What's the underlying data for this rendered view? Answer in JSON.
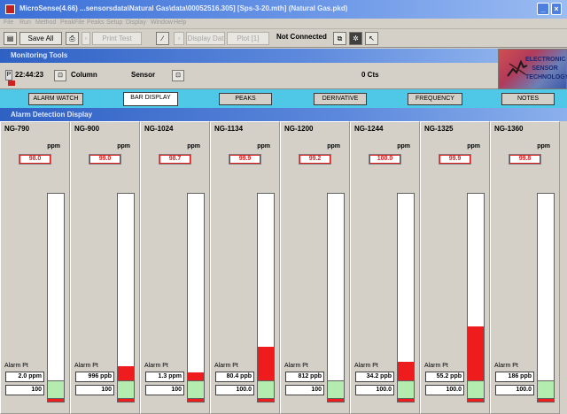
{
  "window": {
    "title": "MicroSense(4.66)   ...sensorsdata\\Natural Gas\\data\\00052516.305] [Sps-3-20.mth] (Natural Gas.pkd)"
  },
  "menu": [
    "File",
    "Run",
    "Method",
    "PeakFile",
    "Peaks",
    "Setup",
    "Display",
    "Window",
    "Help"
  ],
  "toolbar": {
    "save_all": "Save All",
    "dim_label_1": "Print Test",
    "dim_label_2": "Display Dat",
    "dim_label_3": "Plot [1]",
    "status": "Not Connected"
  },
  "monitoring": {
    "title": "Monitoring Tools",
    "time": "22:44:23",
    "column_label": "Column",
    "sensor_label": "Sensor",
    "counts": "0 Cts"
  },
  "logo": {
    "text_line1": "ELECTRONIC",
    "text_line2": "SENSOR",
    "text_line3": "TECHNOLOGY"
  },
  "tabs": [
    "ALARM WATCH",
    "BAR DISPLAY",
    "PEAKS",
    "DERIVATIVE",
    "FREQUENCY",
    "NOTES"
  ],
  "active_tab": "BAR DISPLAY",
  "section": {
    "title": "Alarm Detection Display"
  },
  "alarm_pt_label": "Alarm Pt",
  "channels": [
    {
      "name": "NG-790",
      "unit": "ppm",
      "value": "98.0",
      "alarm": "2.0 ppm",
      "range": "100",
      "level": 0.1
    },
    {
      "name": "NG-900",
      "unit": "ppm",
      "value": "99.0",
      "alarm": "996 ppb",
      "range": "100",
      "level": 0.17
    },
    {
      "name": "NG-1024",
      "unit": "ppm",
      "value": "98.7",
      "alarm": "1.3 ppm",
      "range": "100",
      "level": 0.14
    },
    {
      "name": "NG-1134",
      "unit": "ppm",
      "value": "99.9",
      "alarm": "80.4 ppb",
      "range": "100.0",
      "level": 0.26
    },
    {
      "name": "NG-1200",
      "unit": "ppm",
      "value": "99.2",
      "alarm": "812 ppb",
      "range": "100",
      "level": 0.04
    },
    {
      "name": "NG-1244",
      "unit": "ppm",
      "value": "100.0",
      "alarm": "34.2 ppb",
      "range": "100.0",
      "level": 0.19
    },
    {
      "name": "NG-1325",
      "unit": "ppm",
      "value": "99.9",
      "alarm": "55.2 ppb",
      "range": "100.0",
      "level": 0.36
    },
    {
      "name": "NG-1360",
      "unit": "ppm",
      "value": "99.8",
      "alarm": "186 ppb",
      "range": "100.0",
      "level": 0.1
    }
  ],
  "colors": {
    "bar_fill": "#ee1c1c",
    "green_zone": "#b4ecb0",
    "tab_strip": "#4fc8e8"
  }
}
